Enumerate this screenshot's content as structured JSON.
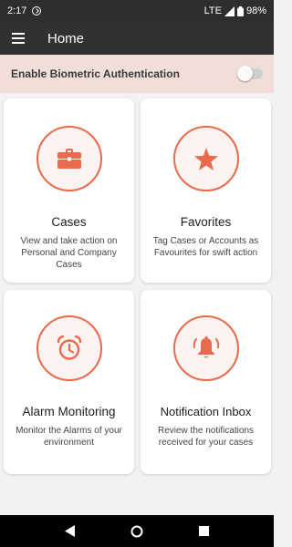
{
  "status_bar": {
    "time": "2:17",
    "network": "LTE",
    "battery": "98%"
  },
  "app_bar": {
    "title": "Home"
  },
  "biometric": {
    "label": "Enable Biometric Authentication",
    "enabled": false
  },
  "cards": [
    {
      "title": "Cases",
      "description": "View and take action on Personal and Company Cases",
      "icon": "briefcase-icon"
    },
    {
      "title": "Favorites",
      "description": "Tag Cases or Accounts as Favourites for swift action",
      "icon": "star-icon"
    },
    {
      "title": "Alarm Monitoring",
      "description": "Monitor the Alarms of your environment",
      "icon": "alarm-clock-icon"
    },
    {
      "title": "Notification Inbox",
      "description": "Review the notifications received for your cases",
      "icon": "bell-icon"
    }
  ],
  "colors": {
    "accent": "#e96a4c",
    "app_bar": "#2f3133",
    "biometric_row": "#f2ded9",
    "background": "#f2f2f2"
  }
}
